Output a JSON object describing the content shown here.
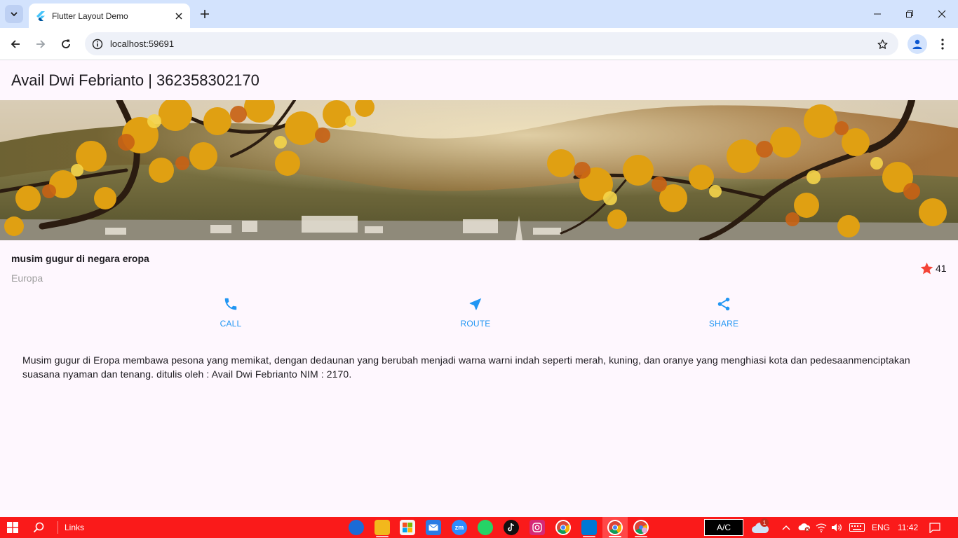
{
  "browser": {
    "tab_title": "Flutter Layout Demo",
    "url": "localhost:59691"
  },
  "page": {
    "appbar_title": "Avail Dwi Febrianto | 362358302170",
    "heading": "musim gugur di negara eropa",
    "subheading": "Europa",
    "favorite_count": "41",
    "buttons": [
      {
        "label": "CALL",
        "icon": "phone-icon"
      },
      {
        "label": "ROUTE",
        "icon": "near-me-icon"
      },
      {
        "label": "SHARE",
        "icon": "share-icon"
      }
    ],
    "description": "Musim gugur di Eropa membawa pesona yang memikat, dengan dedaunan yang berubah menjadi warna warni indah seperti merah, kuning, dan oranye yang menghiasi kota dan pedesaanmenciptakan suasana nyaman dan tenang. ditulis oleh : Avail Dwi Febrianto NIM : 2170.",
    "accent_color": "#2196f3",
    "star_color": "#f44336"
  },
  "taskbar": {
    "links_label": "Links",
    "ac_label": "A/C",
    "language": "ENG",
    "time": "11:42",
    "weather_badge": "1"
  }
}
